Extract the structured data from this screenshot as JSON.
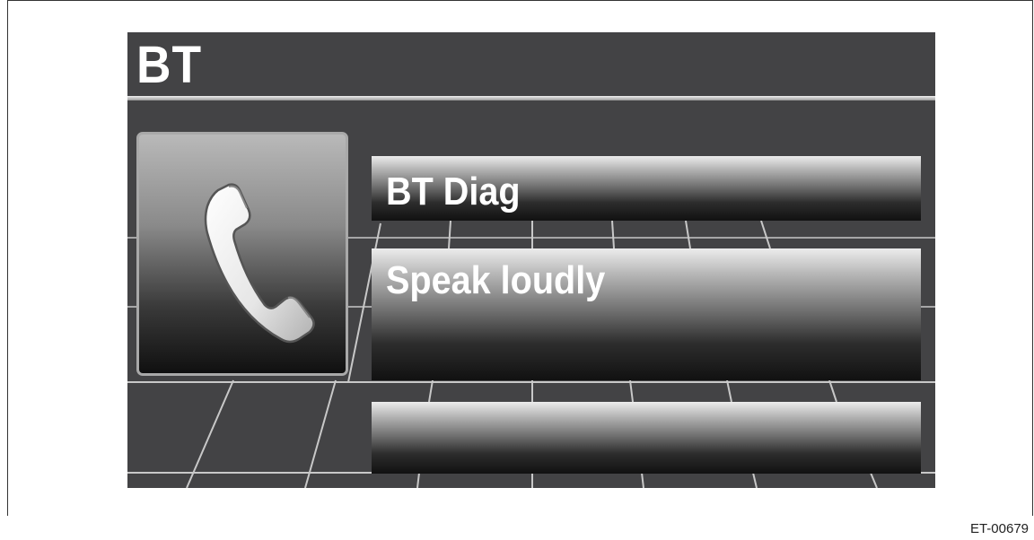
{
  "screen": {
    "title": "BT",
    "icon": "phone-handset-icon",
    "menu_items": [
      {
        "label": "BT  Diag"
      },
      {
        "label": "Speak  loudly"
      },
      {
        "label": ""
      }
    ]
  },
  "figure_code": "ET-00679",
  "colors": {
    "screen_background": "#434345",
    "title_text": "#ffffff",
    "grid_lines": "#bdbdbd"
  }
}
